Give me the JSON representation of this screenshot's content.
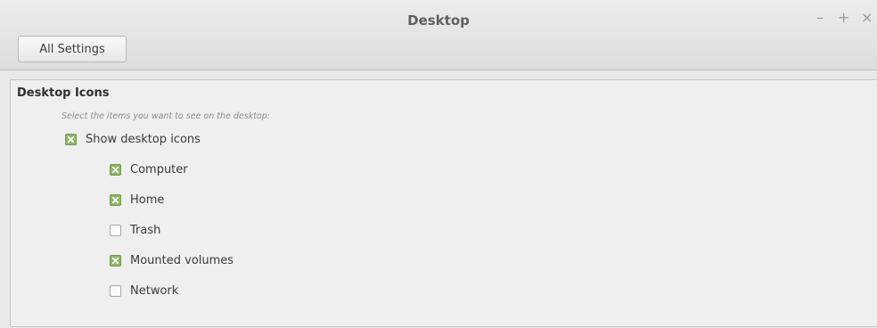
{
  "window": {
    "title": "Desktop",
    "controls": [
      "–",
      "+",
      "×"
    ]
  },
  "toolbar": {
    "all_settings_label": "All Settings"
  },
  "section": {
    "title": "Desktop Icons",
    "hint": "Select the items you want to see on the desktop:"
  },
  "options": {
    "show_desktop_icons": {
      "label": "Show desktop icons",
      "checked": true
    },
    "computer": {
      "label": "Computer",
      "checked": true
    },
    "home": {
      "label": "Home",
      "checked": true
    },
    "trash": {
      "label": "Trash",
      "checked": false
    },
    "mounted_volumes": {
      "label": "Mounted volumes",
      "checked": true
    },
    "network": {
      "label": "Network",
      "checked": false
    }
  },
  "colors": {
    "checkbox_checked": "#8fb868"
  }
}
